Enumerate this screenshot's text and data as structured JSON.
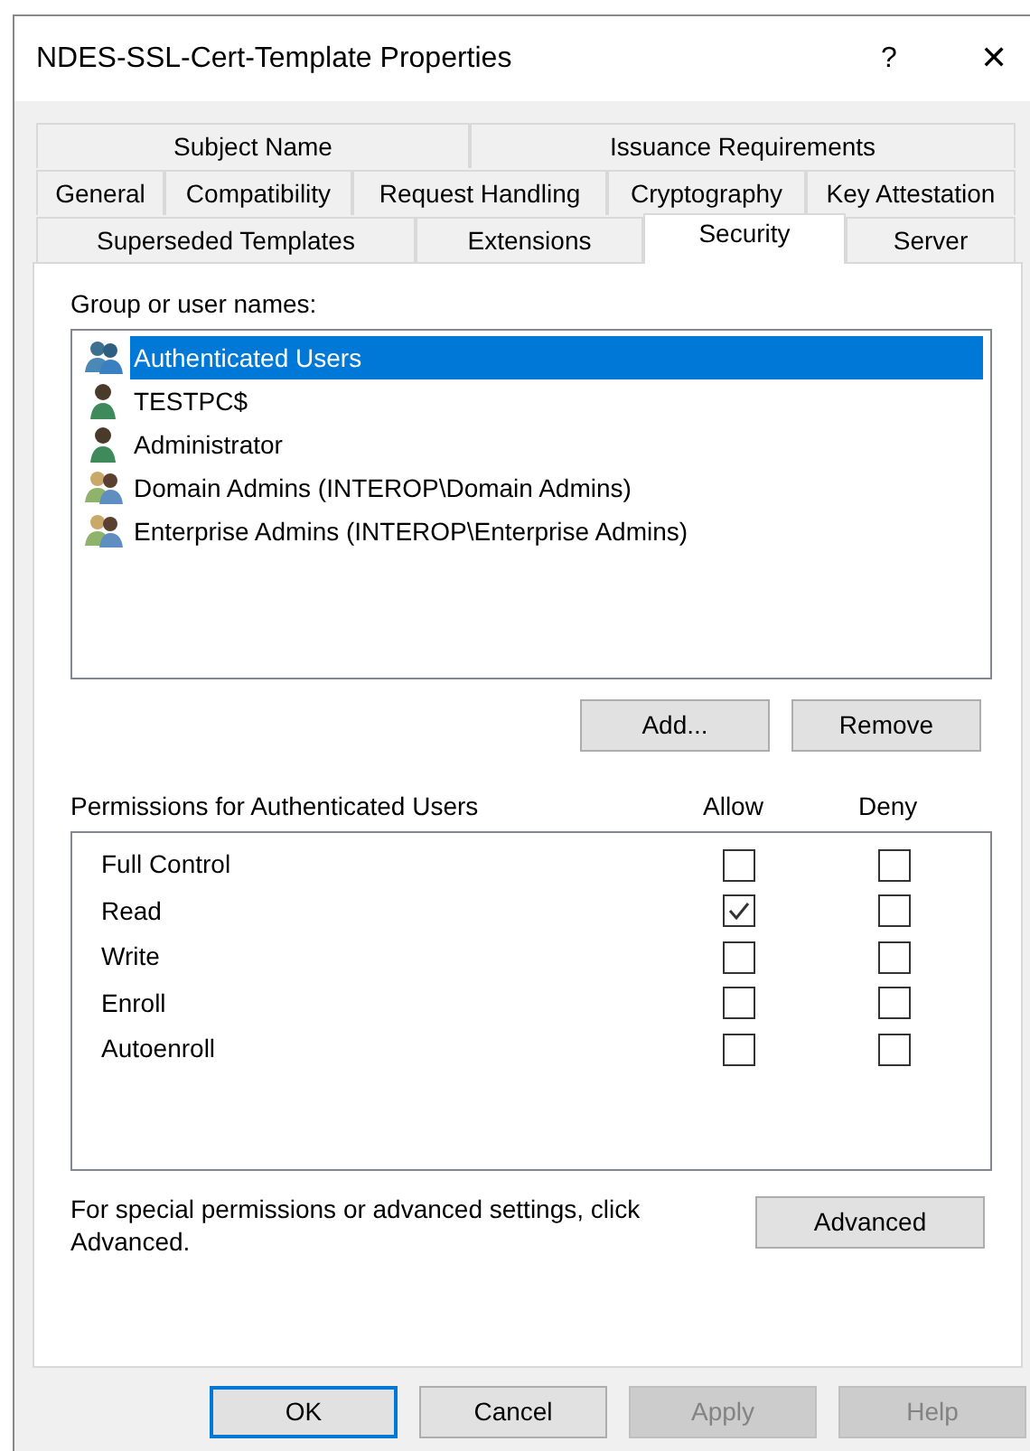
{
  "window": {
    "title": "NDES-SSL-Cert-Template Properties",
    "help_button": "?",
    "close_button": "✕"
  },
  "tab_rows": [
    [
      {
        "label": "Subject Name",
        "selected": false
      },
      {
        "label": "Issuance Requirements",
        "selected": false
      }
    ],
    [
      {
        "label": "General",
        "selected": false
      },
      {
        "label": "Compatibility",
        "selected": false
      },
      {
        "label": "Request Handling",
        "selected": false
      },
      {
        "label": "Cryptography",
        "selected": false
      },
      {
        "label": "Key Attestation",
        "selected": false
      }
    ],
    [
      {
        "label": "Superseded Templates",
        "selected": false
      },
      {
        "label": "Extensions",
        "selected": false
      },
      {
        "label": "Security",
        "selected": true
      },
      {
        "label": "Server",
        "selected": false
      }
    ]
  ],
  "users": {
    "label": "Group or user names:",
    "items": [
      {
        "name": "Authenticated Users",
        "kind": "special-group",
        "selected": true
      },
      {
        "name": "TESTPC$",
        "kind": "user",
        "selected": false
      },
      {
        "name": "Administrator",
        "kind": "user",
        "selected": false
      },
      {
        "name": "Domain Admins (INTEROP\\Domain Admins)",
        "kind": "group",
        "selected": false
      },
      {
        "name": "Enterprise Admins (INTEROP\\Enterprise Admins)",
        "kind": "group",
        "selected": false
      }
    ],
    "buttons": [
      "Add...",
      "Remove"
    ]
  },
  "permissions": {
    "label": "Permissions for Authenticated Users",
    "columns": [
      "Allow",
      "Deny"
    ],
    "rows": [
      {
        "name": "Full Control",
        "allow": false,
        "deny": false
      },
      {
        "name": "Read",
        "allow": true,
        "deny": false
      },
      {
        "name": "Write",
        "allow": false,
        "deny": false
      },
      {
        "name": "Enroll",
        "allow": false,
        "deny": false
      },
      {
        "name": "Autoenroll",
        "allow": false,
        "deny": false
      }
    ]
  },
  "advanced": {
    "text": "For special permissions or advanced settings, click Advanced.",
    "button": "Advanced"
  },
  "footer_buttons": [
    {
      "label": "OK",
      "kind": "default",
      "disabled": false
    },
    {
      "label": "Cancel",
      "kind": "normal",
      "disabled": false
    },
    {
      "label": "Apply",
      "kind": "normal",
      "disabled": true
    },
    {
      "label": "Help",
      "kind": "normal",
      "disabled": true
    }
  ]
}
